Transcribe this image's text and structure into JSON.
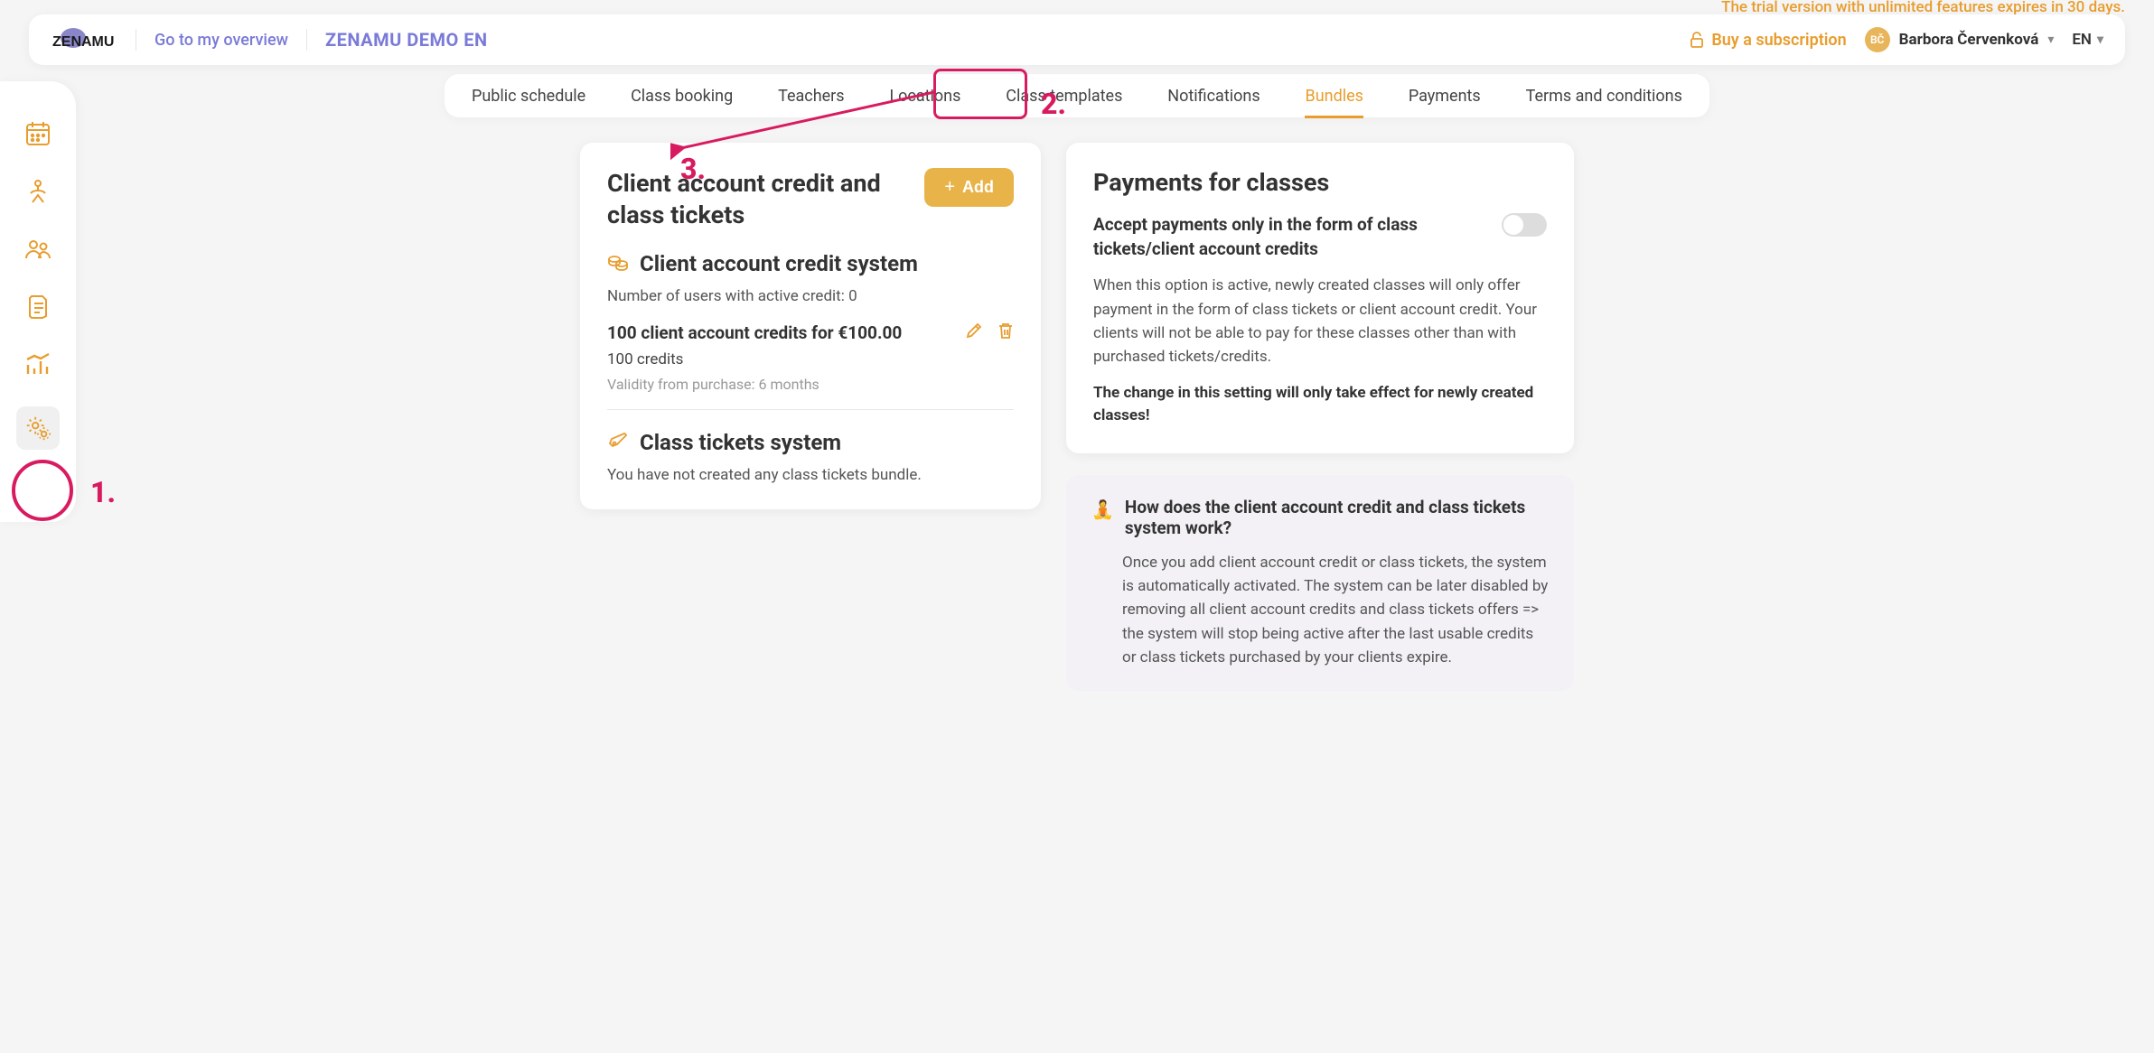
{
  "top": {
    "trial": "The trial version with unlimited features expires in 30 days.",
    "overview": "Go to my overview",
    "site": "ZENAMU DEMO EN",
    "buy": "Buy a subscription",
    "avatar": "BČ",
    "user": "Barbora Červenková",
    "lang": "EN"
  },
  "tabs": [
    "Public schedule",
    "Class booking",
    "Teachers",
    "Locations",
    "Class templates",
    "Notifications",
    "Bundles",
    "Payments",
    "Terms and conditions"
  ],
  "active_tab": "Bundles",
  "left": {
    "title": "Client account credit and class tickets",
    "add": "Add",
    "sec1": {
      "title": "Client account credit system",
      "statLabel": "Number of users with active credit:",
      "statVal": "0",
      "item": "100 client account credits for €100.00",
      "sub": "100 credits",
      "valid": "Validity from purchase: 6 months"
    },
    "sec2": {
      "title": "Class tickets system",
      "empty": "You have not created any class tickets bundle."
    }
  },
  "right": {
    "title": "Payments for classes",
    "toggle": "Accept payments only in the form of class tickets/client account credits",
    "desc": "When this option is active, newly created classes will only offer payment in the form of class tickets or client account credit. Your clients will not be able to pay for these classes other than with purchased tickets/credits.",
    "warn": "The change in this setting will only take effect for newly created classes!"
  },
  "info": {
    "emoji": "🧘",
    "title": "How does the client account credit and class tickets system work?",
    "body": "Once you add client account credit or class tickets, the system is automatically activated. The system can be later disabled by removing all client account credits and class tickets offers => the system will stop being active after the last usable credits or class tickets purchased by your clients expire."
  },
  "annotations": {
    "a1": "1.",
    "a2": "2.",
    "a3": "3."
  }
}
